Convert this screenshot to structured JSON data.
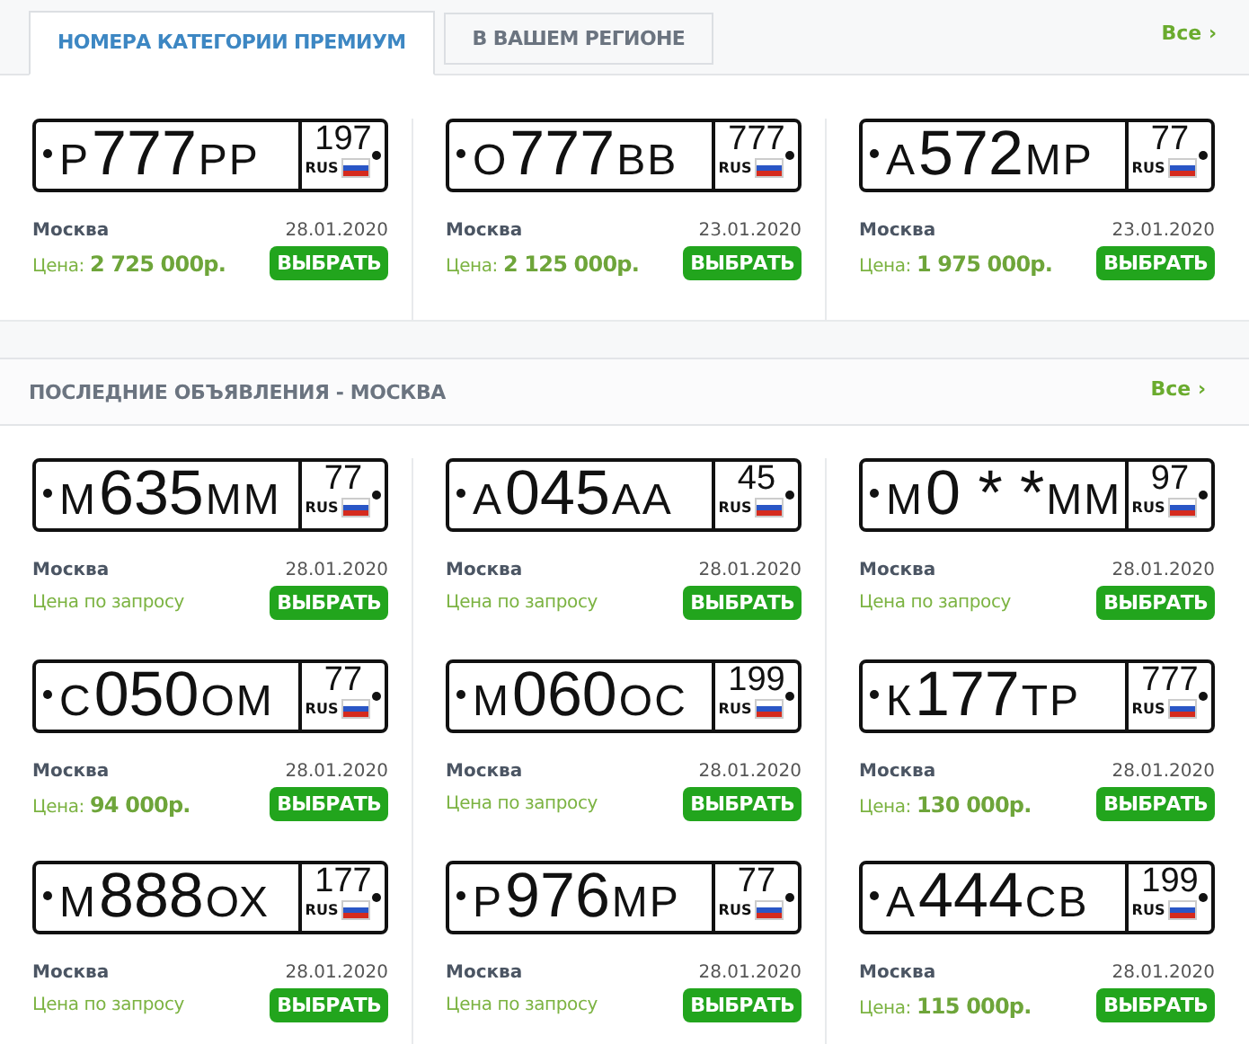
{
  "tabs": [
    {
      "label": "НОМЕРА КАТЕГОРИИ ПРЕМИУМ",
      "selected": true
    },
    {
      "label": "В ВАШЕМ РЕГИОНЕ",
      "selected": false
    }
  ],
  "premium_all_link": "Все ›",
  "premium": [
    {
      "plate": {
        "letter": "Р",
        "digits": "777",
        "letters": "РР",
        "region": "197",
        "country": "RUS"
      },
      "city": "Москва",
      "date": "28.01.2020",
      "price": {
        "kind": "price",
        "label": "Цена:",
        "value": "2 725 000р."
      },
      "button": "ВЫБРАТЬ"
    },
    {
      "plate": {
        "letter": "О",
        "digits": "777",
        "letters": "ВВ",
        "region": "777",
        "country": "RUS"
      },
      "city": "Москва",
      "date": "23.01.2020",
      "price": {
        "kind": "price",
        "label": "Цена:",
        "value": "2 125 000р."
      },
      "button": "ВЫБРАТЬ"
    },
    {
      "plate": {
        "letter": "А",
        "digits": "572",
        "letters": "МР",
        "region": "77",
        "country": "RUS"
      },
      "city": "Москва",
      "date": "23.01.2020",
      "price": {
        "kind": "price",
        "label": "Цена:",
        "value": "1 975 000р."
      },
      "button": "ВЫБРАТЬ"
    }
  ],
  "latest": {
    "title": "ПОСЛЕДНИЕ ОБЪЯВЛЕНИЯ - МОСКВА",
    "all_link": "Все ›",
    "items": [
      {
        "plate": {
          "letter": "М",
          "digits": "635",
          "letters": "ММ",
          "region": "77",
          "country": "RUS"
        },
        "city": "Москва",
        "date": "28.01.2020",
        "price": {
          "kind": "on_request",
          "label": "Цена по запросу"
        },
        "button": "ВЫБРАТЬ"
      },
      {
        "plate": {
          "letter": "А",
          "digits": "045",
          "letters": "АА",
          "region": "45",
          "country": "RUS"
        },
        "city": "Москва",
        "date": "28.01.2020",
        "price": {
          "kind": "on_request",
          "label": "Цена по запросу"
        },
        "button": "ВЫБРАТЬ"
      },
      {
        "plate": {
          "letter": "М",
          "digits": "0 * *",
          "letters": "ММ",
          "region": "97",
          "country": "RUS"
        },
        "city": "Москва",
        "date": "28.01.2020",
        "price": {
          "kind": "on_request",
          "label": "Цена по запросу"
        },
        "button": "ВЫБРАТЬ"
      },
      {
        "plate": {
          "letter": "С",
          "digits": "050",
          "letters": "ОМ",
          "region": "77",
          "country": "RUS"
        },
        "city": "Москва",
        "date": "28.01.2020",
        "price": {
          "kind": "price",
          "label": "Цена:",
          "value": "94 000р."
        },
        "button": "ВЫБРАТЬ"
      },
      {
        "plate": {
          "letter": "М",
          "digits": "060",
          "letters": "ОС",
          "region": "199",
          "country": "RUS"
        },
        "city": "Москва",
        "date": "28.01.2020",
        "price": {
          "kind": "on_request",
          "label": "Цена по запросу"
        },
        "button": "ВЫБРАТЬ"
      },
      {
        "plate": {
          "letter": "К",
          "digits": "177",
          "letters": "ТР",
          "region": "777",
          "country": "RUS"
        },
        "city": "Москва",
        "date": "28.01.2020",
        "price": {
          "kind": "price",
          "label": "Цена:",
          "value": "130 000р."
        },
        "button": "ВЫБРАТЬ"
      },
      {
        "plate": {
          "letter": "М",
          "digits": "888",
          "letters": "ОХ",
          "region": "177",
          "country": "RUS"
        },
        "city": "Москва",
        "date": "28.01.2020",
        "price": {
          "kind": "on_request",
          "label": "Цена по запросу"
        },
        "button": "ВЫБРАТЬ"
      },
      {
        "plate": {
          "letter": "Р",
          "digits": "976",
          "letters": "МР",
          "region": "77",
          "country": "RUS"
        },
        "city": "Москва",
        "date": "28.01.2020",
        "price": {
          "kind": "on_request",
          "label": "Цена по запросу"
        },
        "button": "ВЫБРАТЬ"
      },
      {
        "plate": {
          "letter": "А",
          "digits": "444",
          "letters": "СВ",
          "region": "199",
          "country": "RUS"
        },
        "city": "Москва",
        "date": "28.01.2020",
        "price": {
          "kind": "price",
          "label": "Цена:",
          "value": "115 000р."
        },
        "button": "ВЫБРАТЬ"
      }
    ]
  }
}
